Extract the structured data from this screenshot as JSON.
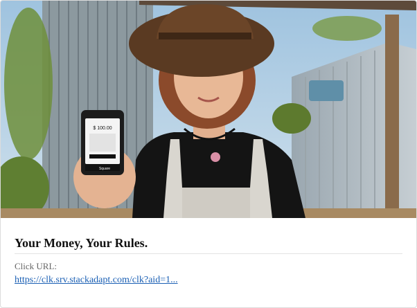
{
  "ad": {
    "image_alt_icon": "woman-holding-card-reader-image",
    "phone_amount": "$ 100.00",
    "phone_brand": "Square",
    "title": "Your Money, Your Rules.",
    "click_url_label": "Click URL:",
    "click_url_text": "https://clk.srv.stackadapt.com/clk?aid=1..."
  }
}
